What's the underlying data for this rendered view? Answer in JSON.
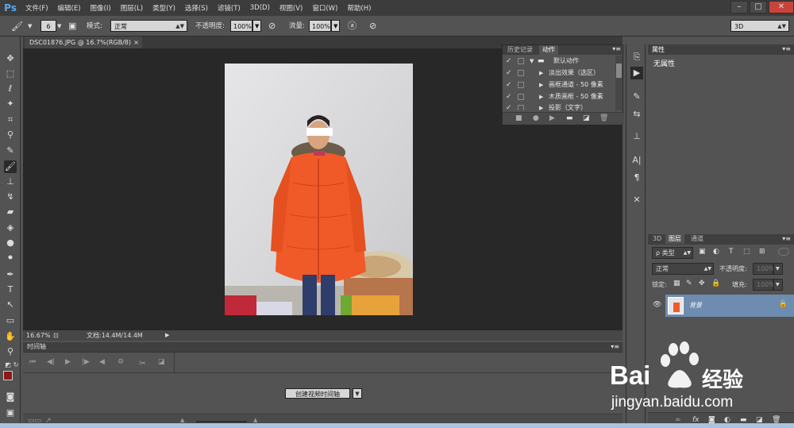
{
  "app": {
    "logo": "Ps",
    "menu": [
      "文件(F)",
      "编辑(E)",
      "图像(I)",
      "图层(L)",
      "类型(Y)",
      "选择(S)",
      "滤镜(T)",
      "3D(D)",
      "视图(V)",
      "窗口(W)",
      "帮助(H)"
    ],
    "window_controls": [
      "–",
      "□",
      "✕"
    ]
  },
  "options": {
    "brush_size": "6",
    "mode_label": "模式:",
    "mode_value": "正常",
    "opacity_label": "不透明度:",
    "opacity_value": "100%",
    "flow_label": "流量:",
    "flow_value": "100%",
    "workspace": "3D"
  },
  "document": {
    "tab_title": "DSC01876.JPG @ 16.7%(RGB/8)",
    "tab_close": "×",
    "zoom": "16.67%",
    "doc_size": "文档:14.4M/14.4M"
  },
  "timeline": {
    "title": "时间轴",
    "create_button": "创建视频时间轴"
  },
  "actions_panel": {
    "tabs": [
      "历史记录",
      "动作"
    ],
    "active_tab": 1,
    "items": [
      {
        "label": "默认动作",
        "folder": true
      },
      {
        "label": "淡出效果（选区）",
        "folder": false
      },
      {
        "label": "画框通道 - 50 像素",
        "folder": false
      },
      {
        "label": "木质画框 - 50 像素",
        "folder": false
      },
      {
        "label": "投影（文字）",
        "folder": false
      }
    ]
  },
  "properties_panel": {
    "title": "属性",
    "content": "无属性"
  },
  "layers_panel": {
    "tabs": [
      "3D",
      "图层",
      "通道"
    ],
    "active_tab": 1,
    "filter_label": "ρ 类型",
    "blend_mode": "正常",
    "opacity_label": "不透明度:",
    "opacity_value": "100%",
    "lock_label": "锁定:",
    "fill_label": "填充:",
    "fill_value": "100%",
    "layer_name": "背景"
  },
  "watermark": {
    "brand": "Bai",
    "brand_cn": "经验",
    "url": "jingyan.baidu.com"
  },
  "colors": {
    "menubar": "#3c3c3c",
    "panel": "#535353",
    "canvas": "#282828",
    "accent_blue": "#6e8cb0",
    "foreground_color": "#8b1a1a",
    "background_color": "#000000",
    "coat": "#f05a28"
  }
}
